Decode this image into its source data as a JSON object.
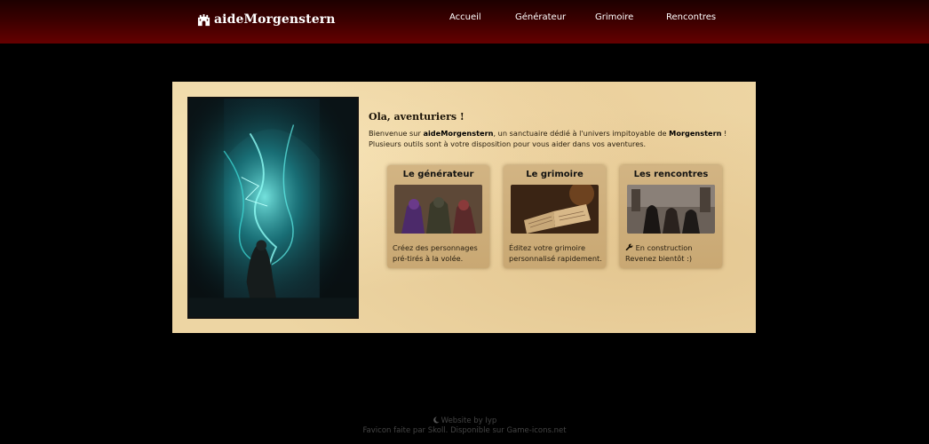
{
  "header": {
    "brand": "aideMorgenstern",
    "brand_icon": "castle-gate-icon",
    "nav": [
      "Accueil",
      "Générateur",
      "Grimoire",
      "Rencontres"
    ]
  },
  "welcome": {
    "title": "Ola, aventuriers !",
    "text_1": "Bienvenue sur ",
    "site_name": "aideMorgenstern",
    "text_2": ", un sanctuaire dédié à l'univers impitoyable de ",
    "universe": "Morgenstern",
    "text_3": " ! Plusieurs outils sont à votre disposition pour vous aider dans vos aventures."
  },
  "cards": [
    {
      "title": "Le générateur",
      "desc": "Créez des personnages pré-tirés à la volée."
    },
    {
      "title": "Le grimoire",
      "desc": "Éditez votre grimoire personnalisé rapidement."
    },
    {
      "title": "Les rencontres",
      "desc_line1": "En construction",
      "desc_line2": "Revenez bientôt :)",
      "icon": "wrench-icon"
    }
  ],
  "footer": {
    "line1": "Website by Iyp",
    "line2": "Favicon faite par Skoll. Disponible sur Game-icons.net",
    "icon": "moon-icon"
  },
  "colors": {
    "header_top": "#1d0000",
    "header_bottom": "#650000",
    "parchment": "#edd5a3",
    "card": "#d2b483",
    "magic": "#38e8e0"
  }
}
